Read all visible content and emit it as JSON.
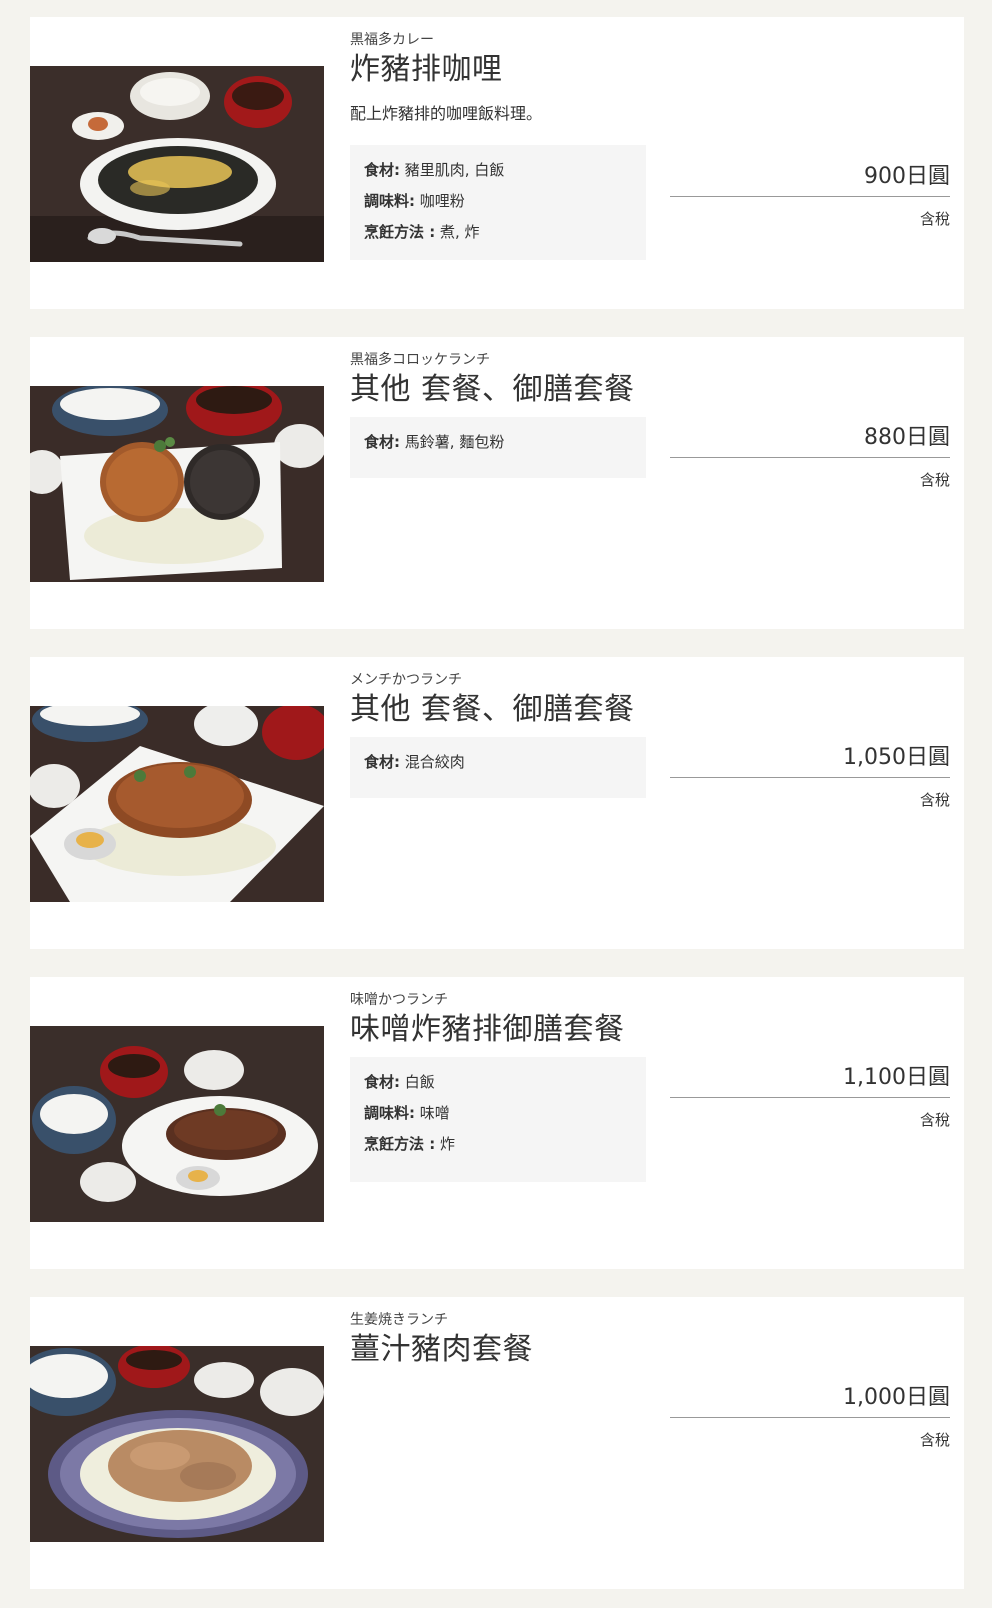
{
  "menu": {
    "items": [
      {
        "subname": "黒福多カレー",
        "title": "炸豬排咖哩",
        "description": "配上炸豬排的咖哩飯料理。",
        "ingredients_label": "食材:",
        "ingredients": "豬里肌肉, 白飯",
        "seasoning_label": "調味料:",
        "seasoning": "咖哩粉",
        "method_label": "烹飪方法 :",
        "method": "煮, 炸",
        "price": "900日圓",
        "tax": "含稅",
        "photo": "katsu-curry"
      },
      {
        "subname": "黒福多コロッケランチ",
        "title": "其他 套餐、御膳套餐",
        "ingredients_label": "食材:",
        "ingredients": "馬鈴薯, 麵包粉",
        "price": "880日圓",
        "tax": "含稅",
        "photo": "croquette-lunch"
      },
      {
        "subname": "メンチかつランチ",
        "title": "其他 套餐、御膳套餐",
        "ingredients_label": "食材:",
        "ingredients": "混合絞肉",
        "price": "1,050日圓",
        "tax": "含稅",
        "photo": "menchi-katsu-lunch"
      },
      {
        "subname": "味噌かつランチ",
        "title": "味噌炸豬排御膳套餐",
        "ingredients_label": "食材:",
        "ingredients": "白飯",
        "seasoning_label": "調味料:",
        "seasoning": "味噌",
        "method_label": "烹飪方法 :",
        "method": "炸",
        "price": "1,100日圓",
        "tax": "含稅",
        "photo": "miso-katsu-lunch"
      },
      {
        "subname": "生姜焼きランチ",
        "title": "薑汁豬肉套餐",
        "price": "1,000日圓",
        "tax": "含稅",
        "photo": "ginger-pork-lunch"
      }
    ]
  }
}
